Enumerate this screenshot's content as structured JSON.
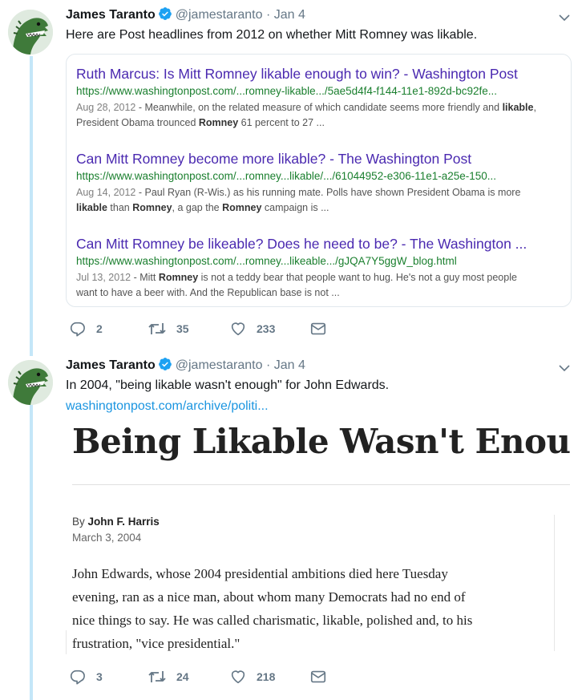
{
  "tweets": [
    {
      "author": {
        "name": "James Taranto",
        "handle": "@jamestaranto",
        "date": "Jan 4"
      },
      "separator": "·",
      "text": "Here are Post headlines from 2012 on whether Mitt Romney was likable.",
      "search_results": [
        {
          "title": "Ruth Marcus: Is Mitt Romney likable enough to win? - Washington Post",
          "url": "https://www.washingtonpost.com/...romney-likable.../5ae5d4f4-f144-11e1-892d-bc92fe...",
          "date": "Aug 28, 2012",
          "snippet_line1": " - Meanwhile, on the related measure of which candidate seems more friendly and ",
          "snippet_bold1": "likable",
          "snippet_line2a": "President Obama trounced ",
          "snippet_bold2": "Romney",
          "snippet_line2b": " 61 percent to 27 ..."
        },
        {
          "title": "Can Mitt Romney become more likable? - The Washington Post",
          "url": "https://www.washingtonpost.com/...romney...likable/.../61044952-e306-11e1-a25e-150...",
          "date": "Aug 14, 2012",
          "snippet_line1": " - Paul Ryan (R-Wis.) as his running mate. Polls have shown President Obama is more",
          "snippet_bold1": "likable",
          "snippet_line2a": " than ",
          "snippet_bold2": "Romney",
          "snippet_line2b": ", a gap the ",
          "snippet_bold3": "Romney",
          "snippet_line2c": " campaign is ..."
        },
        {
          "title": "Can Mitt Romney be likeable? Does he need to be? - The Washington ...",
          "url": "https://www.washingtonpost.com/...romney...likeable.../gJQA7Y5ggW_blog.html",
          "date": "Jul 13, 2012",
          "snippet_line1a": " - Mitt ",
          "snippet_bold1": "Romney",
          "snippet_line1b": " is not a teddy bear that people want to hug. He's not a guy most people",
          "snippet_line2": "want to have a beer with. And the Republican base is not ..."
        }
      ],
      "stats": {
        "replies": "2",
        "retweets": "35",
        "likes": "233"
      }
    },
    {
      "author": {
        "name": "James Taranto",
        "handle": "@jamestaranto",
        "date": "Jan 4"
      },
      "separator": "·",
      "text": "In 2004, \"being likable wasn't enough\" for John Edwards.",
      "link": "washingtonpost.com/archive/politi...",
      "article": {
        "headline": "Being Likable Wasn't Enough",
        "by_prefix": "By ",
        "author": "John F. Harris",
        "date": "March 3, 2004",
        "body": [
          "John Edwards, whose 2004 presidential ambitions died here Tuesday",
          "evening, ran as a nice man, about whom many Democrats had no end of",
          "nice things to say. He was called charismatic, likable, polished and, to his",
          "frustration, \"vice presidential.\""
        ]
      },
      "stats": {
        "replies": "3",
        "retweets": "24",
        "likes": "218"
      }
    }
  ],
  "colors": {
    "link": "#1b95e0",
    "thread_line": "#c4e6f8",
    "result_title": "#4a29b0",
    "result_url": "#1a7f2e"
  },
  "icons": [
    "avatar-dinosaur",
    "verified-icon",
    "chevron-down-icon",
    "reply-icon",
    "retweet-icon",
    "like-icon",
    "dm-icon"
  ]
}
